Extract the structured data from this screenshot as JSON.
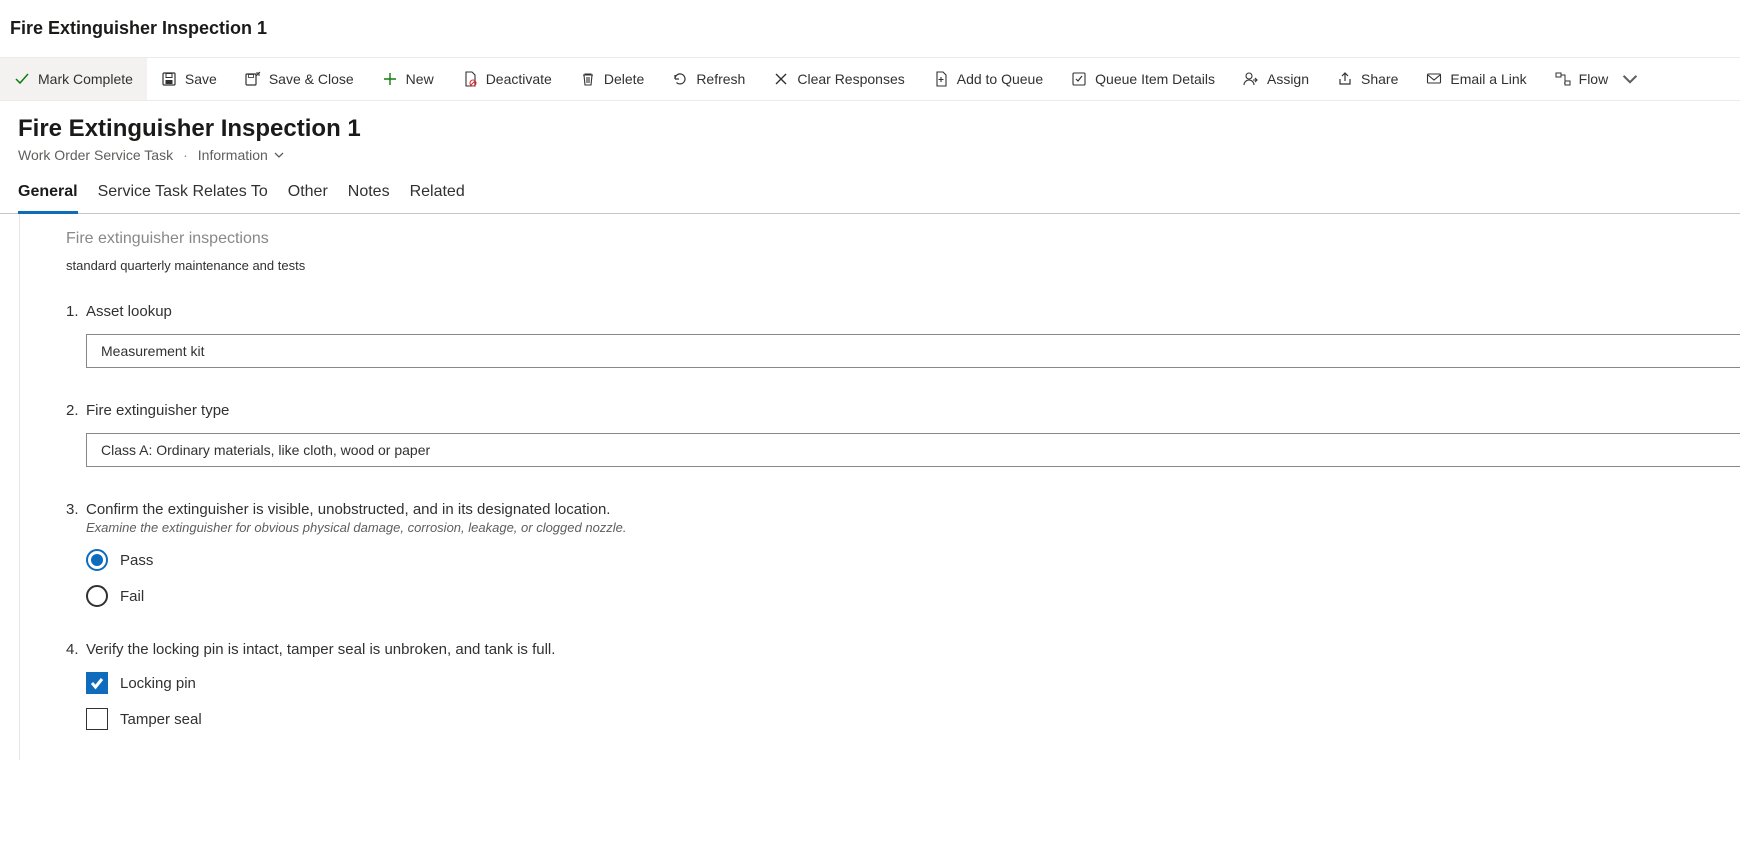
{
  "top_title": "Fire Extinguisher Inspection 1",
  "toolbar": {
    "mark_complete": "Mark Complete",
    "save": "Save",
    "save_close": "Save & Close",
    "new": "New",
    "deactivate": "Deactivate",
    "delete": "Delete",
    "refresh": "Refresh",
    "clear_responses": "Clear Responses",
    "add_to_queue": "Add to Queue",
    "queue_item_details": "Queue Item Details",
    "assign": "Assign",
    "share": "Share",
    "email_a_link": "Email a Link",
    "flow": "Flow"
  },
  "header": {
    "record_title": "Fire Extinguisher Inspection 1",
    "entity": "Work Order Service Task",
    "form": "Information"
  },
  "tabs": {
    "general": "General",
    "relates": "Service Task Relates To",
    "other": "Other",
    "notes": "Notes",
    "related": "Related"
  },
  "form": {
    "section_heading": "Fire extinguisher inspections",
    "section_desc": "standard quarterly maintenance and tests",
    "q1": {
      "num": "1.",
      "label": "Asset lookup",
      "value": "Measurement kit"
    },
    "q2": {
      "num": "2.",
      "label": "Fire extinguisher type",
      "value": "Class A: Ordinary materials, like cloth, wood or paper"
    },
    "q3": {
      "num": "3.",
      "label": "Confirm the extinguisher is visible, unobstructed, and in its designated location.",
      "sub": "Examine the extinguisher for obvious physical damage, corrosion, leakage, or clogged nozzle.",
      "opt_pass": "Pass",
      "opt_fail": "Fail",
      "selected": "pass"
    },
    "q4": {
      "num": "4.",
      "label": "Verify the locking pin is intact, tamper seal is unbroken, and tank is full.",
      "opt_pin": "Locking pin",
      "opt_seal": "Tamper seal",
      "pin_checked": true,
      "seal_checked": false
    }
  }
}
